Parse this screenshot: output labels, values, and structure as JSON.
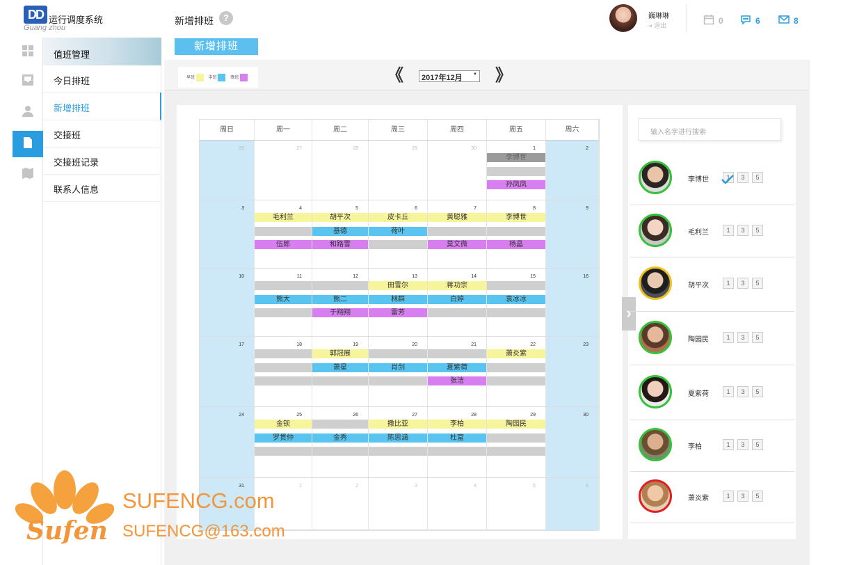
{
  "app": {
    "title": "运行调度系统",
    "subtitle": "Guang zhou",
    "logo_text": "DD"
  },
  "menu": {
    "header": "值班管理",
    "items": [
      {
        "label": "今日排班",
        "active": false
      },
      {
        "label": "新增排班",
        "active": true
      },
      {
        "label": "交接班",
        "active": false
      },
      {
        "label": "交接班记录",
        "active": false
      },
      {
        "label": "联系人信息",
        "active": false
      }
    ]
  },
  "rail": {
    "icons": [
      "grid-icon",
      "inbox-icon",
      "user-icon",
      "document-icon",
      "map-icon"
    ],
    "active_index": 3,
    "accent": "#2a9de0"
  },
  "header": {
    "page_title": "新增排班",
    "help_glyph": "?",
    "user_name": "巍琳琳",
    "logout_label": "退出",
    "stats": [
      {
        "icon": "calendar-icon",
        "value": "0",
        "color": "#bbbbbb"
      },
      {
        "icon": "chat-icon",
        "value": "6",
        "color": "#2a9de0"
      },
      {
        "icon": "mail-icon",
        "value": "8",
        "color": "#2a9de0"
      }
    ]
  },
  "tab": {
    "label": "新增排班",
    "color": "#5bc0f0"
  },
  "toolbar": {
    "legend": [
      {
        "label": "早班",
        "color": "#f7f59c"
      },
      {
        "label": "中班",
        "color": "#5ac4f0"
      },
      {
        "label": "晚班",
        "color": "#d77ef0"
      }
    ],
    "prev_glyph": "《",
    "next_glyph": "》",
    "month": "2017年12月"
  },
  "calendar": {
    "weekdays": [
      "周日",
      "周一",
      "周二",
      "周三",
      "周四",
      "周五",
      "周六"
    ],
    "weeks": [
      {
        "days": [
          {
            "n": "26",
            "other": true
          },
          {
            "n": "27",
            "other": true
          },
          {
            "n": "28",
            "other": true
          },
          {
            "n": "29",
            "other": true
          },
          {
            "n": "30",
            "other": true
          },
          {
            "n": "1",
            "shifts": [
              {
                "c": "dg",
                "t": "李博世"
              },
              {
                "c": "g",
                "t": ""
              },
              {
                "c": "p",
                "t": "孙凤凤"
              }
            ]
          },
          {
            "n": "2"
          }
        ]
      },
      {
        "days": [
          {
            "n": "3"
          },
          {
            "n": "4",
            "shifts": [
              {
                "c": "y",
                "t": "毛利兰"
              },
              {
                "c": "g",
                "t": ""
              },
              {
                "c": "p",
                "t": "伍郎"
              }
            ]
          },
          {
            "n": "5",
            "shifts": [
              {
                "c": "y",
                "t": "胡平次"
              },
              {
                "c": "b",
                "t": "基德"
              },
              {
                "c": "p",
                "t": "和路雪"
              }
            ]
          },
          {
            "n": "6",
            "shifts": [
              {
                "c": "y",
                "t": "皮卡丘"
              },
              {
                "c": "b",
                "t": "荷叶"
              },
              {
                "c": "g",
                "t": ""
              }
            ]
          },
          {
            "n": "7",
            "shifts": [
              {
                "c": "y",
                "t": "黄聪雅"
              },
              {
                "c": "g",
                "t": ""
              },
              {
                "c": "p",
                "t": "莫文微"
              }
            ]
          },
          {
            "n": "8",
            "shifts": [
              {
                "c": "y",
                "t": "李博世"
              },
              {
                "c": "g",
                "t": ""
              },
              {
                "c": "p",
                "t": "杨晶"
              }
            ]
          },
          {
            "n": "9"
          }
        ]
      },
      {
        "days": [
          {
            "n": "10"
          },
          {
            "n": "11",
            "shifts": [
              {
                "c": "g",
                "t": ""
              },
              {
                "c": "b",
                "t": "熊大"
              },
              {
                "c": "g",
                "t": ""
              }
            ]
          },
          {
            "n": "12",
            "shifts": [
              {
                "c": "g",
                "t": ""
              },
              {
                "c": "b",
                "t": "熊二"
              },
              {
                "c": "p",
                "t": "于翔翔"
              }
            ]
          },
          {
            "n": "13",
            "shifts": [
              {
                "c": "y",
                "t": "田雪尔"
              },
              {
                "c": "b",
                "t": "林群"
              },
              {
                "c": "p",
                "t": "雷芳"
              }
            ]
          },
          {
            "n": "14",
            "shifts": [
              {
                "c": "y",
                "t": "蒋功宗"
              },
              {
                "c": "b",
                "t": "白婷"
              },
              {
                "c": "g",
                "t": ""
              }
            ]
          },
          {
            "n": "15",
            "shifts": [
              {
                "c": "g",
                "t": ""
              },
              {
                "c": "b",
                "t": "袁冰冰"
              },
              {
                "c": "g",
                "t": ""
              }
            ]
          },
          {
            "n": "16"
          }
        ]
      },
      {
        "days": [
          {
            "n": "17"
          },
          {
            "n": "18",
            "shifts": [
              {
                "c": "g",
                "t": ""
              },
              {
                "c": "g",
                "t": ""
              },
              {
                "c": "g",
                "t": ""
              }
            ]
          },
          {
            "n": "19",
            "shifts": [
              {
                "c": "y",
                "t": "郭冠展"
              },
              {
                "c": "b",
                "t": "萧星"
              },
              {
                "c": "g",
                "t": ""
              }
            ]
          },
          {
            "n": "20",
            "shifts": [
              {
                "c": "g",
                "t": ""
              },
              {
                "c": "b",
                "t": "肖剑"
              },
              {
                "c": "g",
                "t": ""
              }
            ]
          },
          {
            "n": "21",
            "shifts": [
              {
                "c": "g",
                "t": ""
              },
              {
                "c": "b",
                "t": "夏紫荷"
              },
              {
                "c": "p",
                "t": "张洁"
              }
            ]
          },
          {
            "n": "22",
            "shifts": [
              {
                "c": "y",
                "t": "萧炎紫"
              },
              {
                "c": "g",
                "t": ""
              },
              {
                "c": "g",
                "t": ""
              }
            ]
          },
          {
            "n": "23"
          }
        ]
      },
      {
        "days": [
          {
            "n": "24"
          },
          {
            "n": "25",
            "shifts": [
              {
                "c": "y",
                "t": "金钡"
              },
              {
                "c": "b",
                "t": "罗贯仲"
              },
              {
                "c": "g",
                "t": ""
              }
            ]
          },
          {
            "n": "26",
            "shifts": [
              {
                "c": "g",
                "t": ""
              },
              {
                "c": "b",
                "t": "金秀"
              },
              {
                "c": "g",
                "t": ""
              }
            ]
          },
          {
            "n": "27",
            "shifts": [
              {
                "c": "y",
                "t": "撒比亚"
              },
              {
                "c": "b",
                "t": "陈思涵"
              },
              {
                "c": "g",
                "t": ""
              }
            ]
          },
          {
            "n": "28",
            "shifts": [
              {
                "c": "y",
                "t": "李柏"
              },
              {
                "c": "b",
                "t": "杜富"
              },
              {
                "c": "g",
                "t": ""
              }
            ]
          },
          {
            "n": "29",
            "shifts": [
              {
                "c": "y",
                "t": "陶园民"
              },
              {
                "c": "g",
                "t": ""
              },
              {
                "c": "g",
                "t": ""
              }
            ]
          },
          {
            "n": "30"
          }
        ]
      },
      {
        "days": [
          {
            "n": "31"
          },
          {
            "n": "1",
            "other": true
          },
          {
            "n": "2",
            "other": true
          },
          {
            "n": "3",
            "other": true
          },
          {
            "n": "4",
            "other": true
          },
          {
            "n": "5",
            "other": true
          },
          {
            "n": "6",
            "other": true
          }
        ]
      }
    ]
  },
  "people": {
    "search_placeholder": "输入名字进行搜索",
    "expand_glyph": "›",
    "list": [
      {
        "name": "李博世",
        "ring": "#37c03a",
        "skin": "#e8c4a8",
        "hair": "#2b2522",
        "bg": "#dcdcdc",
        "checked": true
      },
      {
        "name": "毛利兰",
        "ring": "#37c03a",
        "skin": "#f2d5c2",
        "hair": "#3a2b24",
        "bg": "#c8c8c8",
        "checked": false
      },
      {
        "name": "胡平次",
        "ring": "#f2c01e",
        "skin": "#e8c8b0",
        "hair": "#1e1e1e",
        "bg": "#4a4f58",
        "checked": false
      },
      {
        "name": "陶园民",
        "ring": "#37c03a",
        "skin": "#e6b89a",
        "hair": "#5a3a28",
        "bg": "#b07050",
        "checked": false
      },
      {
        "name": "夏紫荷",
        "ring": "#37c03a",
        "skin": "#f0d0bc",
        "hair": "#231a16",
        "bg": "#ececec",
        "checked": false
      },
      {
        "name": "李柏",
        "ring": "#37c03a",
        "skin": "#dcb08e",
        "hair": "#6a5030",
        "bg": "#7a8a6a",
        "checked": false
      },
      {
        "name": "萧炎紫",
        "ring": "#e02020",
        "skin": "#f0c8a8",
        "hair": "#b08050",
        "bg": "#e8d0b8",
        "checked": false
      }
    ],
    "nums": [
      "1",
      "3",
      "5"
    ]
  },
  "watermark": {
    "logo_text": "Sufen",
    "site": "SUFENCG.com",
    "email": "SUFENCG@163.com",
    "color": "#f3953a"
  }
}
